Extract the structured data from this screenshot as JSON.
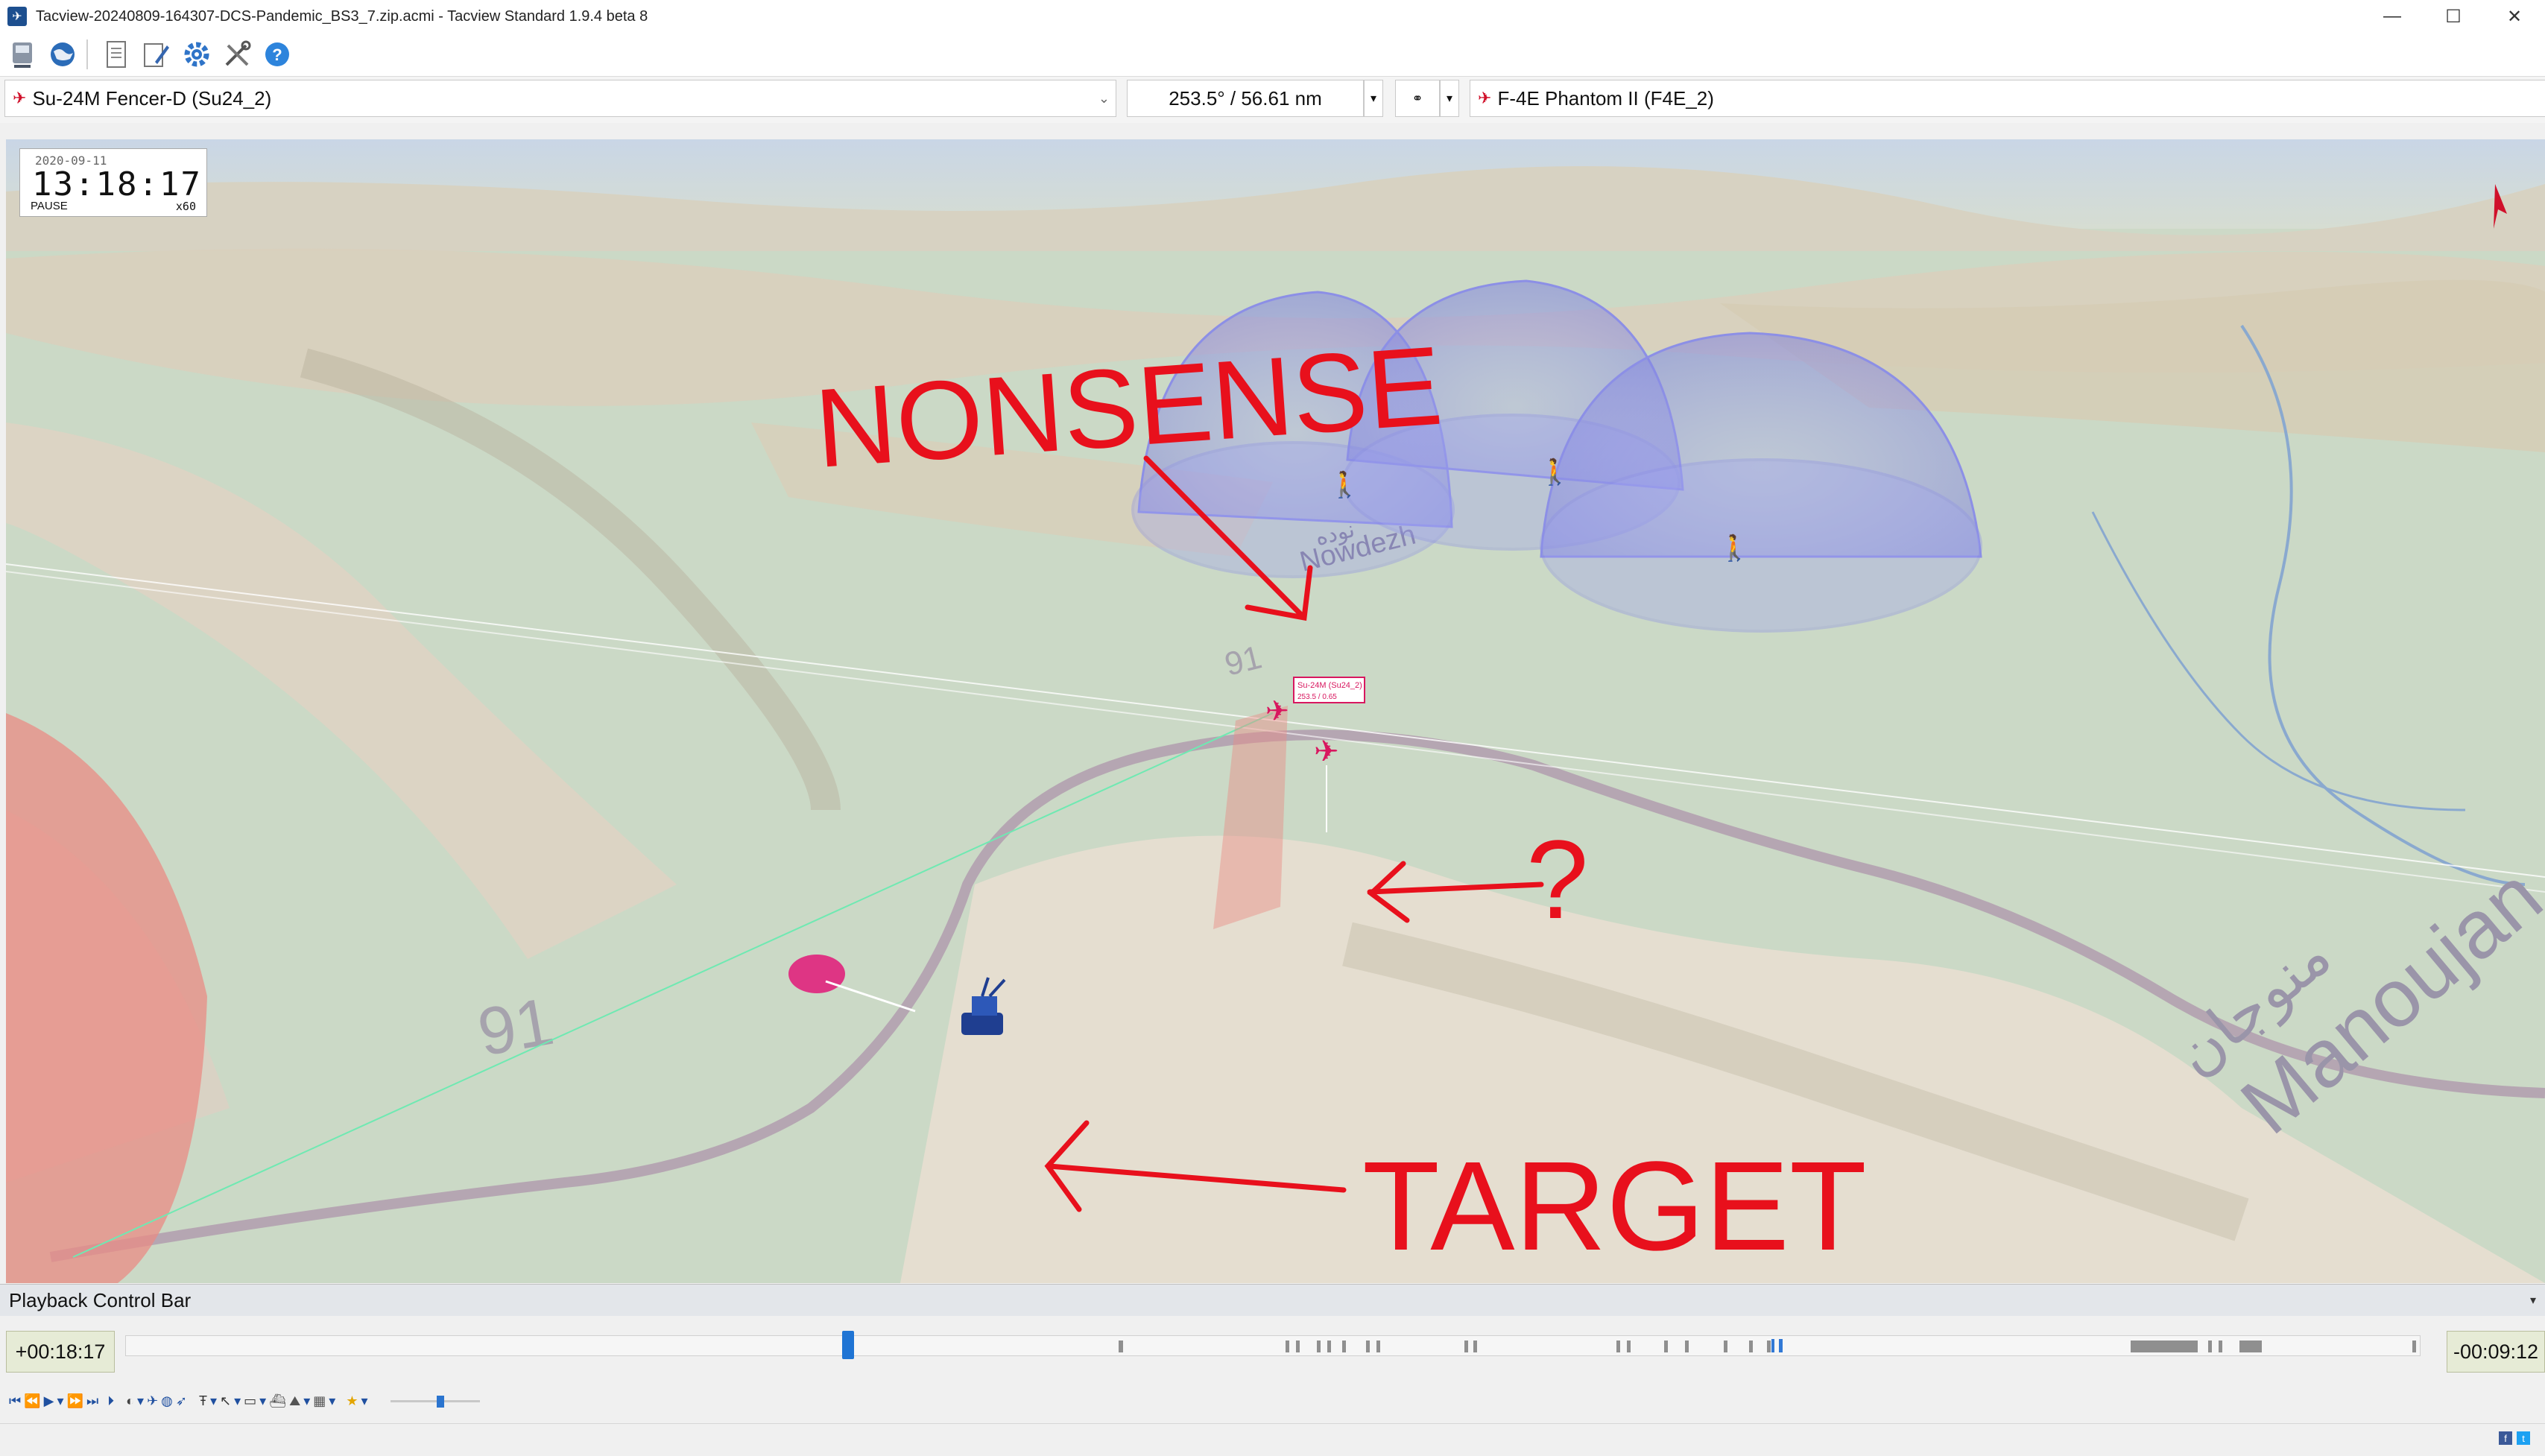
{
  "window": {
    "title": "Tacview-20240809-164307-DCS-Pandemic_BS3_7.zip.acmi - Tacview Standard 1.9.4 beta 8",
    "controls": [
      "minimize",
      "maximize",
      "close"
    ]
  },
  "toolbar": {
    "buttons": [
      {
        "icon": "open-file-icon"
      },
      {
        "icon": "globe-icon"
      },
      {
        "icon": "document-icon"
      },
      {
        "icon": "edit-icon"
      },
      {
        "icon": "gear-icon"
      },
      {
        "icon": "tools-icon"
      },
      {
        "icon": "help-icon"
      }
    ]
  },
  "selectors": {
    "primary_object": "Su-24M Fencer-D (Su24_2)",
    "bearing_range": "253.5° / 56.61 nm",
    "secondary_object": "F-4E Phantom II (F4E_2)"
  },
  "viewport": {
    "clock": {
      "date": "2020-09-11",
      "time": "13:18:17",
      "state": "PAUSE",
      "speed": "x60"
    },
    "map_labels": {
      "town_1": "Nowdezh",
      "town_1_native": "نوده",
      "town_2": "Manoujan",
      "town_2_native": "منوجان",
      "road_a": "91",
      "road_b": "91"
    },
    "aircraft_tag": {
      "name": "Su-24M (Su24_2)",
      "info": "253.5 / 0.65"
    },
    "annotations": {
      "nonsense": "NONSENSE",
      "question": "?",
      "target": "TARGET"
    }
  },
  "playback": {
    "title": "Playback Control Bar",
    "elapsed": "+00:18:17",
    "remaining": "-00:09:12",
    "position": 0.315
  },
  "colors": {
    "annotation_red": "#e8101c",
    "sam_dome": "#8c8fe6",
    "aircraft_magenta": "#d8175f",
    "terrain_green": "#c9d8c4"
  }
}
